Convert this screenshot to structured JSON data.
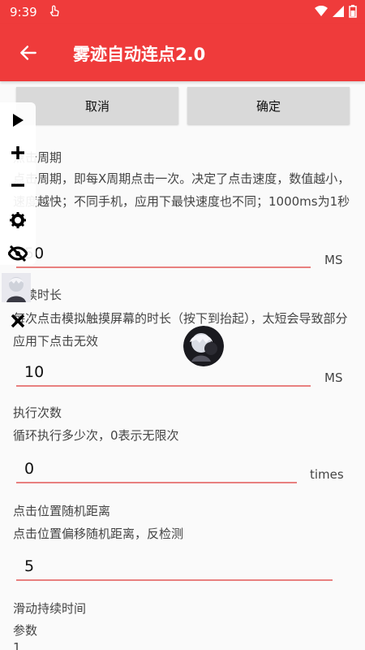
{
  "status_bar": {
    "time": "9:39"
  },
  "app_bar": {
    "title": "雾迹自动连点2.0"
  },
  "buttons": {
    "cancel": "取消",
    "confirm": "确定"
  },
  "sections": [
    {
      "heading": "点击周期",
      "description": "点击周期，即每X周期点击一次。决定了点击速度，数值越小，速度越快；不同手机，应用下最快速度也不同；1000ms为1秒",
      "value": "50",
      "unit": "MS"
    },
    {
      "heading": "持续时长",
      "description": "每次点击模拟触摸屏幕的时长（按下到抬起），太短会导致部分应用下点击无效",
      "value": "10",
      "unit": "MS"
    },
    {
      "heading": "执行次数",
      "description": "循环执行多少次，0表示无限次",
      "value": "0",
      "unit": "times"
    },
    {
      "heading": "点击位置随机距离",
      "description": "点击位置偏移随机距离，反检测",
      "value": "5",
      "unit": ""
    },
    {
      "heading": "滑动持续时间",
      "description": "参数",
      "value": "1",
      "unit": ""
    }
  ],
  "toolbar": [
    "play-icon",
    "plus-icon",
    "minus-icon",
    "gear-icon",
    "eye-off-icon",
    "avatar",
    "close-icon"
  ],
  "colors": {
    "primary": "#ef3b3b",
    "underline": "#e8807f",
    "button": "#d9d9d9"
  }
}
